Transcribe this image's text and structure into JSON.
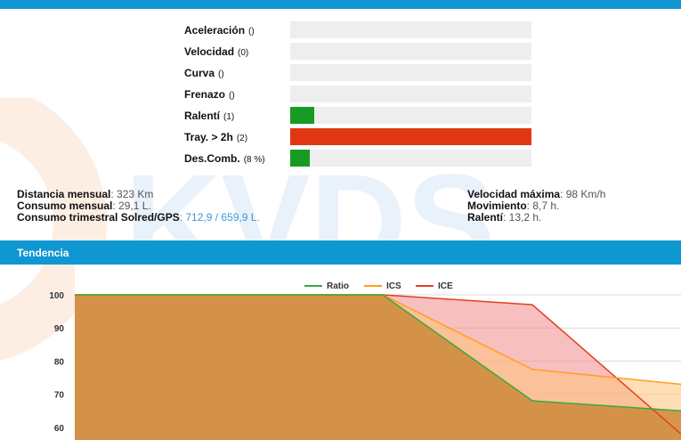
{
  "metrics": [
    {
      "label": "Aceleración",
      "count": "()",
      "fill_fraction": 0,
      "color": "#179b24"
    },
    {
      "label": "Velocidad",
      "count": "(0)",
      "fill_fraction": 0,
      "color": "#179b24"
    },
    {
      "label": "Curva",
      "count": "()",
      "fill_fraction": 0,
      "color": "#179b24"
    },
    {
      "label": "Frenazo",
      "count": "()",
      "fill_fraction": 0,
      "color": "#179b24"
    },
    {
      "label": "Ralentí",
      "count": "(1)",
      "fill_fraction": 0.1,
      "color": "#179b24"
    },
    {
      "label": "Tray. > 2h",
      "count": "(2)",
      "fill_fraction": 1.0,
      "color": "#e03614"
    },
    {
      "label": "Des.Comb.",
      "count": "(8 %)",
      "fill_fraction": 0.08,
      "color": "#179b24"
    }
  ],
  "stats_left": {
    "distance_label": "Distancia mensual",
    "distance_value": ": 323 Km",
    "consumption_label": "Consumo mensual",
    "consumption_value": ": 29,1 L.",
    "quarterly_label": "Consumo trimestral Solred/GPS",
    "quarterly_value": ": 712,9 / 659,9 L."
  },
  "stats_right": {
    "maxspeed_label": "Velocidad máxima",
    "maxspeed_value": ": 98 Km/h",
    "movement_label": "Movimiento",
    "movement_value": ": 8,7 h.",
    "idle_label": "Ralentí",
    "idle_value": ": 13,2 h."
  },
  "section": {
    "title": "Tendencia"
  },
  "colors": {
    "accent": "#0f97d1",
    "ratio": "#3aa83a",
    "ics": "#ff9f1a",
    "ice": "#e0411f"
  },
  "chart_data": {
    "type": "area",
    "x": [
      0,
      1,
      2,
      3
    ],
    "ylim": [
      55,
      100
    ],
    "yticks": [
      100,
      90,
      80,
      70,
      60
    ],
    "legend": "top-center",
    "grid": true,
    "series": [
      {
        "name": "Ratio",
        "values": [
          100,
          100,
          68,
          65
        ]
      },
      {
        "name": "ICS",
        "values": [
          100,
          100,
          77.5,
          73
        ]
      },
      {
        "name": "ICE",
        "values": [
          100,
          100,
          97,
          58
        ]
      }
    ]
  }
}
